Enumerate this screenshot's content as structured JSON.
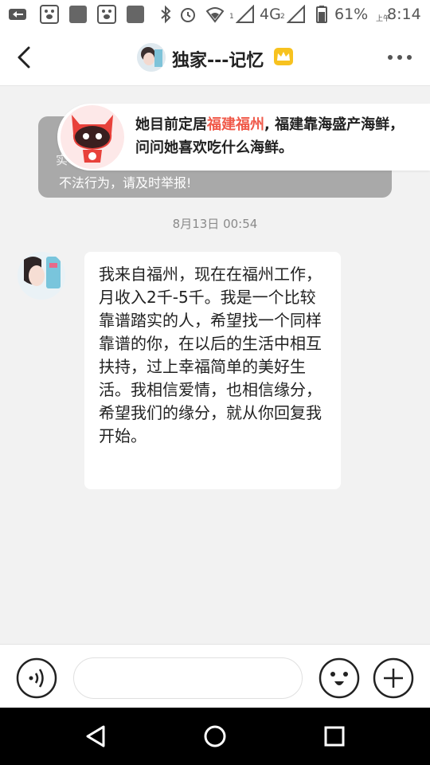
{
  "status_bar": {
    "battery_percent": "61%",
    "time": "8:14",
    "am_pm": "上午",
    "network": "4G",
    "network_sub": "2",
    "signal_sub": "1"
  },
  "header": {
    "title": "独家---记忆"
  },
  "notice": {
    "line1_hidden_fragment": "实",
    "line2": "不法行为，请及时举报!"
  },
  "tip": {
    "prefix": "她目前定居",
    "highlight": "福建福州",
    "suffix": ", 福建靠海盛产海鲜，问问她喜欢吃什么海鲜。"
  },
  "conversation": {
    "timestamp": "8月13日 00:54",
    "messages": [
      {
        "text": "我来自福州，现在在福州工作，月收入2千-5千。我是一个比较靠谱踏实的人，希望找一个同样靠谱的你，在以后的生活中相互扶持，过上幸福简单的美好生活。我相信爱情，也相信缘分，希望我们的缘分，就从你回复我开始。"
      }
    ]
  },
  "input": {
    "placeholder": ""
  },
  "colors": {
    "highlight_red": "#f05a4a",
    "crown_gold": "#f7c21f",
    "notice_gray": "#a9a9a9",
    "background": "#f2f2f2"
  },
  "icons": {
    "back": "chevron-left-icon",
    "more": "more-dots-icon",
    "voice": "voice-icon",
    "emoji": "emoji-icon",
    "plus": "plus-icon",
    "crown": "crown-icon",
    "mascot": "mascot-icon"
  }
}
